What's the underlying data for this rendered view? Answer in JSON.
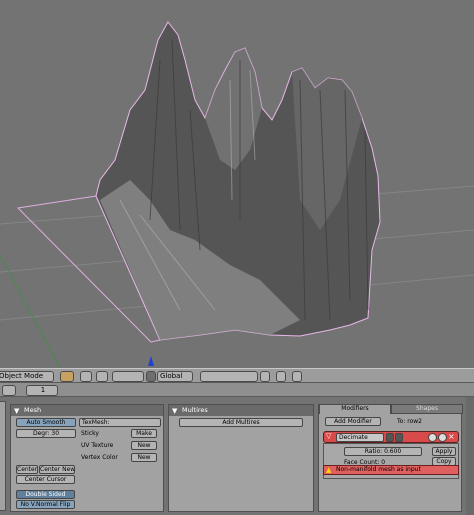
{
  "header": {
    "mode_label": "Object Mode",
    "transform_orientation": "Global"
  },
  "buttons_header": {
    "frame": "1"
  },
  "mesh_panel": {
    "title": "Mesh",
    "auto_smooth": "Auto Smooth",
    "degr": "Degr: 30",
    "center": "Center",
    "center_new": "Center New",
    "center_cursor": "Center Cursor",
    "double_sided": "Double Sided",
    "no_v_normal_flip": "No V.Normal Flip",
    "texmesh_label": "TexMesh:",
    "sticky": "Sticky",
    "sticky_btn": "Make",
    "uv_texture": "UV Texture",
    "uv_btn": "New",
    "vertex_color": "Vertex Color",
    "vcol_btn": "New"
  },
  "multires_panel": {
    "title": "Multires",
    "add_multires": "Add Multires"
  },
  "modifiers_panel": {
    "tab_modifiers": "Modifiers",
    "tab_shapes": "Shapes",
    "add_modifier": "Add Modifier",
    "to_label": "To: row2",
    "modifier_name": "Decimate",
    "ratio": "Ratio: 0.600",
    "apply": "Apply",
    "copy": "Copy",
    "face_count": "Face Count: 0",
    "warning": "Non-manifold mesh as input"
  },
  "colors": {
    "viewport_bg": "#737373",
    "selection_outline": "#e8b8e8",
    "modifier_header": "#d94a4a",
    "warning": "#e06060"
  }
}
